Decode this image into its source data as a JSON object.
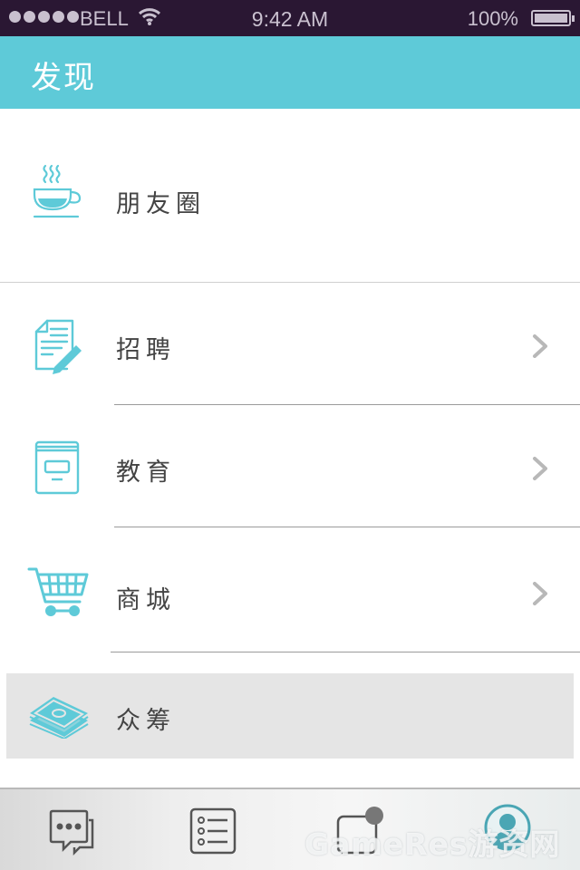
{
  "status_bar": {
    "carrier": "BELL",
    "time": "9:42 AM",
    "battery": "100%"
  },
  "header": {
    "title": "发现"
  },
  "menu": {
    "items": [
      {
        "label": "朋友圈",
        "icon": "coffee-cup-icon",
        "has_chevron": false
      },
      {
        "label": "招聘",
        "icon": "document-pen-icon",
        "has_chevron": true
      },
      {
        "label": "教育",
        "icon": "book-icon",
        "has_chevron": true
      },
      {
        "label": "商城",
        "icon": "shopping-cart-icon",
        "has_chevron": true
      },
      {
        "label": "众筹",
        "icon": "money-stack-icon",
        "has_chevron": false,
        "selected": true
      }
    ],
    "chevron_glyph": "❯"
  },
  "tab_bar": {
    "tabs": [
      {
        "icon": "chat-bubble-icon"
      },
      {
        "icon": "list-icon"
      },
      {
        "icon": "notification-square-icon",
        "badge": true
      },
      {
        "icon": "profile-avatar-icon"
      }
    ]
  },
  "watermark": "GameRes游资网",
  "colors": {
    "accent": "#5ecad8",
    "status_bar_bg": "#2a1733",
    "selected_row_bg": "#e5e5e5",
    "label_text": "#444444"
  }
}
